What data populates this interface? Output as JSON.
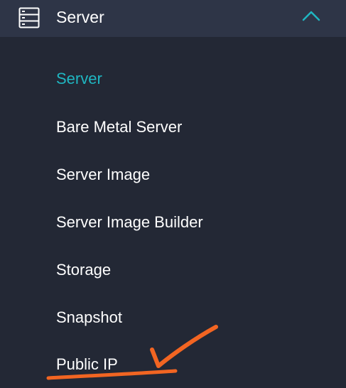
{
  "header": {
    "title": "Server",
    "icon": "server-rack-icon",
    "toggle_icon": "chevron-up-icon",
    "expanded": true
  },
  "menu": {
    "items": [
      {
        "label": "Server",
        "active": true
      },
      {
        "label": "Bare Metal Server",
        "active": false
      },
      {
        "label": "Server Image",
        "active": false
      },
      {
        "label": "Server Image Builder",
        "active": false
      },
      {
        "label": "Storage",
        "active": false
      },
      {
        "label": "Snapshot",
        "active": false
      },
      {
        "label": "Public IP",
        "active": false
      }
    ]
  },
  "annotation": {
    "type": "hand-drawn-checkmark-underline",
    "target": "Public IP"
  },
  "colors": {
    "background": "#232835",
    "header_background": "#2e3547",
    "accent": "#1fb6c1",
    "text": "#ffffff",
    "annotation": "#f26522"
  }
}
